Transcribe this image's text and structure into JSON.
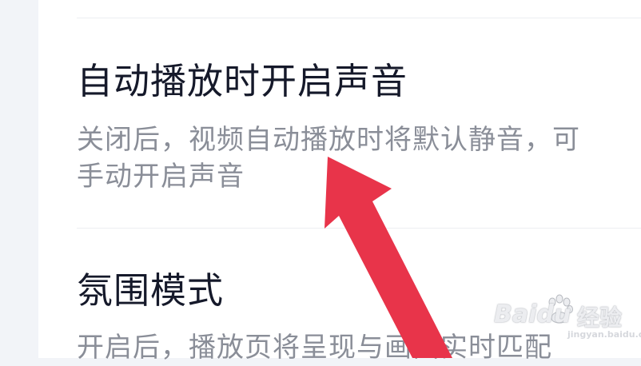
{
  "settings": [
    {
      "title": "自动播放时开启声音",
      "description": "关闭后，视频自动播放时将默认静音，可手动开启声音"
    },
    {
      "title": "氛围模式",
      "description": "开启后，播放页将呈现与画面实时匹配"
    }
  ],
  "annotation": {
    "arrow_color": "#e8344a"
  },
  "watermark": {
    "brand": "Baidu",
    "product": "经验",
    "url": "jingyan.baidu.com"
  }
}
